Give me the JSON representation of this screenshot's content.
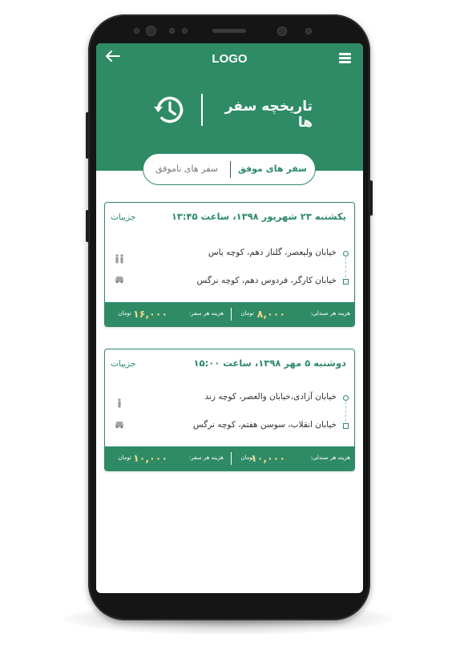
{
  "header": {
    "logo": "LOGO",
    "back_icon": "arrow-left-icon",
    "menu_icon": "hamburger-menu-icon",
    "history_icon": "history-clock-icon",
    "title": "تاریخچه سفر ها"
  },
  "tabs": {
    "successful": "سفر های موفق",
    "failed": "سفر های ناموفق",
    "active": "successful"
  },
  "colors": {
    "primary": "#2e8b66",
    "fare_value": "#f2d98a",
    "phone_body": "#151515"
  },
  "trips": [
    {
      "date": "یکشنبه ۲۳ شهریور ۱۳۹۸، ساعت ۱۳:۴۵",
      "details": "جزییات",
      "origin": "خیابان ولیعصر، گلناز دهم، کوچه یاس",
      "destination": "خیابان کارگر، فردوس دهم، کوچه نرگس",
      "passenger_icon": "two-persons-icon",
      "vehicle_icon": "car-icon",
      "seat_fare_label": "هزینه هر صندلی:",
      "seat_fare": "۸,۰۰۰",
      "trip_fare_label": "هزینه هر سفر:",
      "trip_fare": "۱۶,۰۰۰",
      "currency": "تومان"
    },
    {
      "date": "دوشنبه ۵ مهر ۱۳۹۸، ساعت ۱۵:۰۰",
      "details": "جزییات",
      "origin": "خیابان آزادی،خیابان والعصر، کوچه زند",
      "destination": "خیابان انقلاب، سوسن هفتم، کوچه نرگس",
      "passenger_icon": "person-icon",
      "vehicle_icon": "car-icon",
      "seat_fare_label": "هزینه هر صندلی:",
      "seat_fare": "۱۰,۰۰۰",
      "trip_fare_label": "هزینه هر سفر:",
      "trip_fare": "۱۰,۰۰۰",
      "currency": "تومان"
    }
  ]
}
